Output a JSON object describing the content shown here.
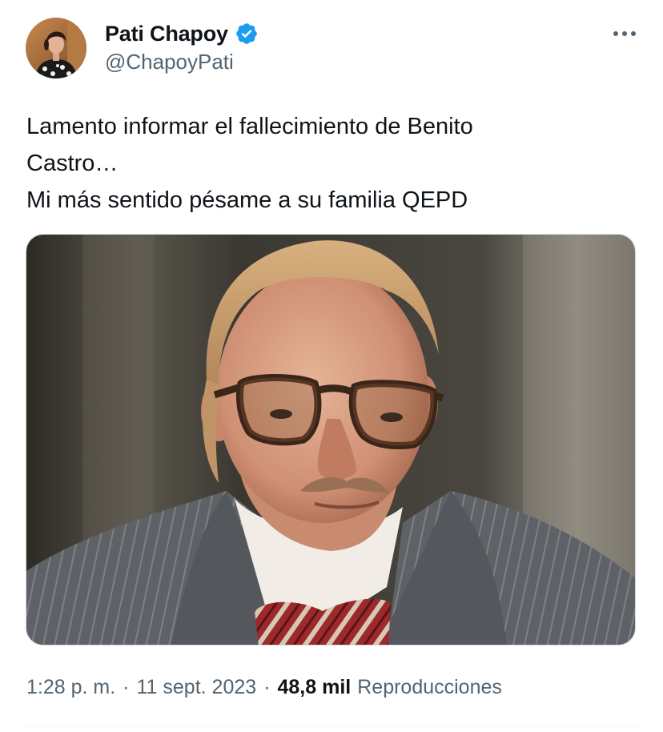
{
  "tweet": {
    "author": {
      "display_name": "Pati Chapoy",
      "handle": "@ChapoyPati",
      "verified": true,
      "verified_color": "#1d9bf0"
    },
    "text_lines": [
      "Lamento informar el fallecimiento de Benito",
      "Castro…",
      "Mi más sentido pésame a su familia QEPD"
    ],
    "media": {
      "type": "photo"
    },
    "meta": {
      "time": "1:28 p. m.",
      "separator": "·",
      "date": "11 sept. 2023",
      "views_count": "48,8 mil",
      "views_label": "Reproducciones"
    },
    "more_icon": "more-horizontal-icon"
  },
  "colors": {
    "text_primary": "#0f1419",
    "text_secondary": "#536471",
    "accent": "#1d9bf0",
    "border": "#cfd9de"
  }
}
